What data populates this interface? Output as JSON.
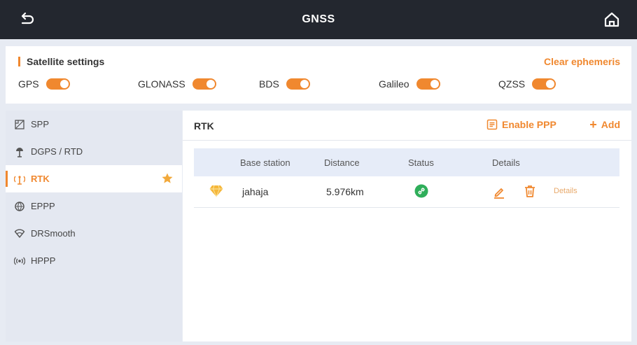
{
  "header": {
    "title": "GNSS",
    "back_icon": "back-arrow-icon",
    "home_icon": "home-icon"
  },
  "satellite": {
    "title": "Satellite settings",
    "clear_label": "Clear ephemeris",
    "systems": [
      {
        "label": "GPS",
        "enabled": true
      },
      {
        "label": "GLONASS",
        "enabled": true
      },
      {
        "label": "BDS",
        "enabled": true
      },
      {
        "label": "Galileo",
        "enabled": true
      },
      {
        "label": "QZSS",
        "enabled": true
      }
    ]
  },
  "sidebar": {
    "items": [
      {
        "label": "SPP",
        "icon": "satellite-icon"
      },
      {
        "label": "DGPS / RTD",
        "icon": "antenna-icon"
      },
      {
        "label": "RTK",
        "icon": "rtk-icon",
        "active": true
      },
      {
        "label": "EPPP",
        "icon": "globe-icon"
      },
      {
        "label": "DRSmooth",
        "icon": "wifi-icon"
      },
      {
        "label": "HPPP",
        "icon": "broadcast-icon"
      }
    ]
  },
  "main": {
    "title": "RTK",
    "enable_ppp_label": "Enable PPP",
    "add_label": "Add",
    "table": {
      "columns": [
        "Base station",
        "Distance",
        "Status",
        "Details"
      ],
      "rows": [
        {
          "base_station": "jahaja",
          "distance": "5.976km",
          "status": "connected",
          "details_label": "Details"
        }
      ]
    }
  },
  "colors": {
    "accent": "#f0882f",
    "topbar": "#23272f",
    "status_ok": "#2fae5a",
    "table_header": "#e6ecf8"
  }
}
